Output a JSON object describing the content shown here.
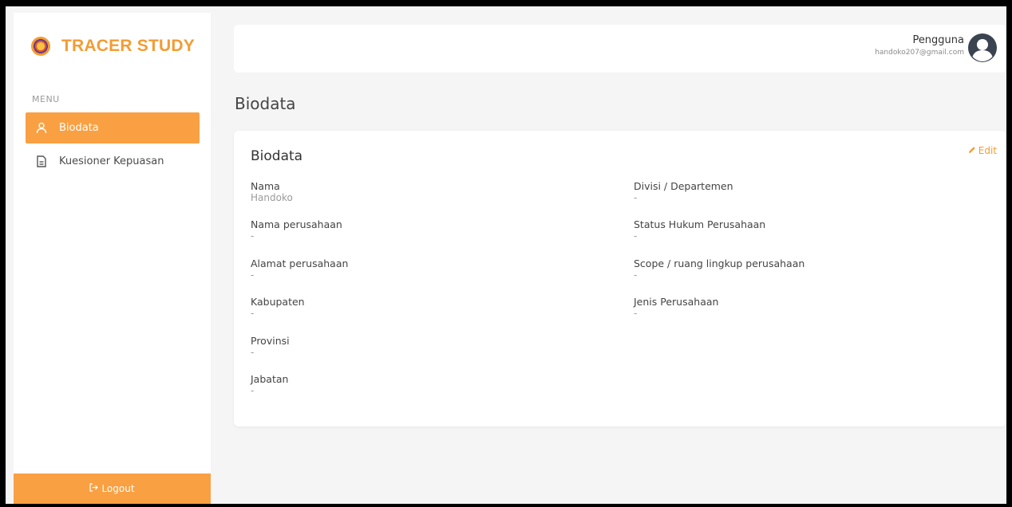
{
  "brand": {
    "title": "TRACER STUDY",
    "logo_icon": "university-seal-icon",
    "accent": "#F39C33"
  },
  "sidebar": {
    "caption": "MENU",
    "items": [
      {
        "label": "Biodata",
        "icon": "user-icon",
        "active": true
      },
      {
        "label": "Kuesioner Kepuasan",
        "icon": "document-icon",
        "active": false
      }
    ],
    "logout_label": "Logout",
    "logout_icon": "logout-icon"
  },
  "header": {
    "user_role": "Pengguna",
    "user_email": "handoko207@gmail.com",
    "avatar_icon": "user-circle-icon"
  },
  "page": {
    "title": "Biodata"
  },
  "card": {
    "title": "Biodata",
    "edit_label": "Edit",
    "edit_icon": "pencil-icon",
    "left_fields": [
      {
        "label": "Nama",
        "value": "Handoko"
      },
      {
        "label": "Nama perusahaan",
        "value": "-"
      },
      {
        "label": "Alamat perusahaan",
        "value": "-"
      },
      {
        "label": "Kabupaten",
        "value": "-"
      },
      {
        "label": "Provinsi",
        "value": "-"
      },
      {
        "label": "Jabatan",
        "value": "-"
      }
    ],
    "right_fields": [
      {
        "label": "Divisi / Departemen",
        "value": "-"
      },
      {
        "label": "Status Hukum Perusahaan",
        "value": "-"
      },
      {
        "label": "Scope / ruang lingkup perusahaan",
        "value": "-"
      },
      {
        "label": "Jenis Perusahaan",
        "value": "-"
      }
    ]
  }
}
